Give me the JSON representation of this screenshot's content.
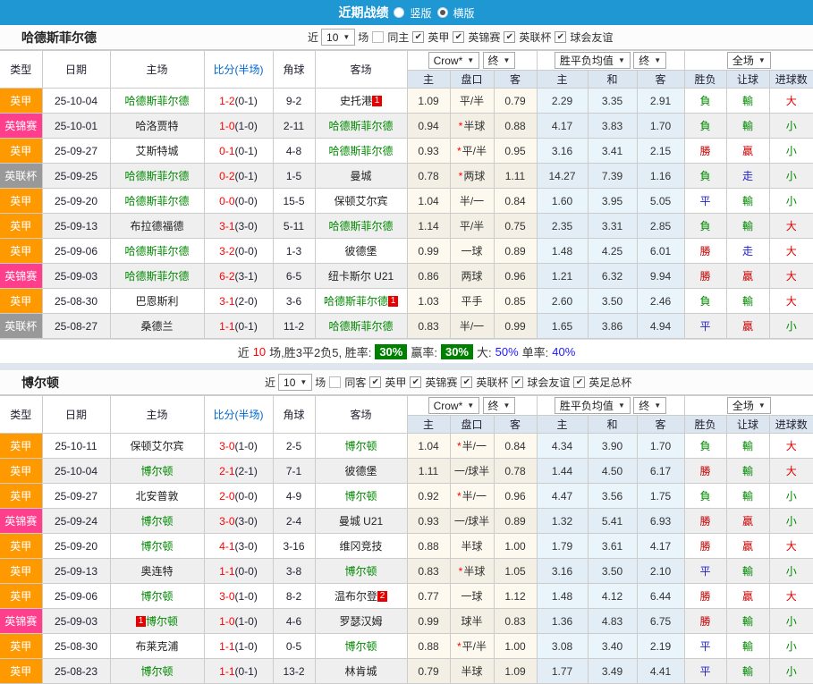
{
  "colors": {
    "accent_blue": "#1e97d3",
    "team_green": "#008800",
    "badge_red": "#e60000",
    "summary_badge_green": "#008000",
    "summary_dark": "#333333",
    "summary_red": "#ff0000",
    "summary_blue": "#1a1aff",
    "type_colors": {
      "英甲": "#ff9900",
      "英锦赛": "#ff3e8c",
      "英联杯": "#999999"
    },
    "result_colors": {
      "勝": "#cc0000",
      "贏": "#cc0000",
      "大": "#dd0000",
      "負": "#008800",
      "輸": "#008800",
      "小": "#008800",
      "平": "#2222cc",
      "走": "#2222cc"
    }
  },
  "topbar": {
    "title": "近期战绩",
    "vertical_label": "竖版",
    "horizontal_label": "横版",
    "selected": "横版"
  },
  "table_header": {
    "cols": [
      "类型",
      "日期",
      "主场",
      "比分(半场)",
      "角球",
      "客场"
    ],
    "sub": [
      "主",
      "盘口",
      "客",
      "主",
      "和",
      "客",
      "胜负",
      "让球",
      "进球数"
    ],
    "bookmaker_select": "Crow*",
    "final_select": "终",
    "avg_select": "胜平负均值",
    "final_select2": "终",
    "scope_select": "全场"
  },
  "sections": [
    {
      "team": "哈德斯菲尔德",
      "filter": {
        "prefix": "近",
        "count": "10",
        "suffix": "场",
        "same_label": "同主",
        "same_checked": false,
        "leagues": [
          {
            "label": "英甲",
            "checked": true
          },
          {
            "label": "英锦赛",
            "checked": true
          },
          {
            "label": "英联杯",
            "checked": true
          },
          {
            "label": "球会友谊",
            "checked": true
          }
        ]
      },
      "rows": [
        {
          "type": "英甲",
          "date": "25-10-04",
          "home": "哈德斯菲尔德",
          "home_team": true,
          "home_badge": "",
          "home_badge_pos": "",
          "score": "1-2",
          "half": "(0-1)",
          "corner": "9-2",
          "away": "史托港",
          "away_team": false,
          "away_badge": "1",
          "away_badge_pos": "after",
          "odds": [
            "1.09",
            "平/半",
            "0.79"
          ],
          "hcap_star": false,
          "avg": [
            "2.29",
            "3.35",
            "2.91"
          ],
          "result": "負",
          "handicap": "輸",
          "goals": "大"
        },
        {
          "type": "英锦赛",
          "date": "25-10-01",
          "home": "哈洛贾特",
          "home_team": false,
          "home_badge": "",
          "home_badge_pos": "",
          "score": "1-0",
          "half": "(1-0)",
          "corner": "2-11",
          "away": "哈德斯菲尔德",
          "away_team": true,
          "away_badge": "",
          "away_badge_pos": "",
          "odds": [
            "0.94",
            "半球",
            "0.88"
          ],
          "hcap_star": true,
          "avg": [
            "4.17",
            "3.83",
            "1.70"
          ],
          "result": "負",
          "handicap": "輸",
          "goals": "小"
        },
        {
          "type": "英甲",
          "date": "25-09-27",
          "home": "艾斯特城",
          "home_team": false,
          "home_badge": "",
          "home_badge_pos": "",
          "score": "0-1",
          "half": "(0-1)",
          "corner": "4-8",
          "away": "哈德斯菲尔德",
          "away_team": true,
          "away_badge": "",
          "away_badge_pos": "",
          "odds": [
            "0.93",
            "平/半",
            "0.95"
          ],
          "hcap_star": true,
          "avg": [
            "3.16",
            "3.41",
            "2.15"
          ],
          "result": "勝",
          "handicap": "贏",
          "goals": "小"
        },
        {
          "type": "英联杯",
          "date": "25-09-25",
          "home": "哈德斯菲尔德",
          "home_team": true,
          "home_badge": "",
          "home_badge_pos": "",
          "score": "0-2",
          "half": "(0-1)",
          "corner": "1-5",
          "away": "曼城",
          "away_team": false,
          "away_badge": "",
          "away_badge_pos": "",
          "odds": [
            "0.78",
            "两球",
            "1.11"
          ],
          "hcap_star": true,
          "avg": [
            "14.27",
            "7.39",
            "1.16"
          ],
          "result": "負",
          "handicap": "走",
          "goals": "小"
        },
        {
          "type": "英甲",
          "date": "25-09-20",
          "home": "哈德斯菲尔德",
          "home_team": true,
          "home_badge": "",
          "home_badge_pos": "",
          "score": "0-0",
          "half": "(0-0)",
          "corner": "15-5",
          "away": "保顿艾尔宾",
          "away_team": false,
          "away_badge": "",
          "away_badge_pos": "",
          "odds": [
            "1.04",
            "半/一",
            "0.84"
          ],
          "hcap_star": false,
          "avg": [
            "1.60",
            "3.95",
            "5.05"
          ],
          "result": "平",
          "handicap": "輸",
          "goals": "小"
        },
        {
          "type": "英甲",
          "date": "25-09-13",
          "home": "布拉德福德",
          "home_team": false,
          "home_badge": "",
          "home_badge_pos": "",
          "score": "3-1",
          "half": "(3-0)",
          "corner": "5-11",
          "away": "哈德斯菲尔德",
          "away_team": true,
          "away_badge": "",
          "away_badge_pos": "",
          "odds": [
            "1.14",
            "平/半",
            "0.75"
          ],
          "hcap_star": false,
          "avg": [
            "2.35",
            "3.31",
            "2.85"
          ],
          "result": "負",
          "handicap": "輸",
          "goals": "大"
        },
        {
          "type": "英甲",
          "date": "25-09-06",
          "home": "哈德斯菲尔德",
          "home_team": true,
          "home_badge": "",
          "home_badge_pos": "",
          "score": "3-2",
          "half": "(0-0)",
          "corner": "1-3",
          "away": "彼德堡",
          "away_team": false,
          "away_badge": "",
          "away_badge_pos": "",
          "odds": [
            "0.99",
            "一球",
            "0.89"
          ],
          "hcap_star": false,
          "avg": [
            "1.48",
            "4.25",
            "6.01"
          ],
          "result": "勝",
          "handicap": "走",
          "goals": "大"
        },
        {
          "type": "英锦赛",
          "date": "25-09-03",
          "home": "哈德斯菲尔德",
          "home_team": true,
          "home_badge": "",
          "home_badge_pos": "",
          "score": "6-2",
          "half": "(3-1)",
          "corner": "6-5",
          "away": "纽卡斯尔 U21",
          "away_team": false,
          "away_badge": "",
          "away_badge_pos": "",
          "odds": [
            "0.86",
            "两球",
            "0.96"
          ],
          "hcap_star": false,
          "avg": [
            "1.21",
            "6.32",
            "9.94"
          ],
          "result": "勝",
          "handicap": "贏",
          "goals": "大"
        },
        {
          "type": "英甲",
          "date": "25-08-30",
          "home": "巴恩斯利",
          "home_team": false,
          "home_badge": "",
          "home_badge_pos": "",
          "score": "3-1",
          "half": "(2-0)",
          "corner": "3-6",
          "away": "哈德斯菲尔德",
          "away_team": true,
          "away_badge": "1",
          "away_badge_pos": "after",
          "odds": [
            "1.03",
            "平手",
            "0.85"
          ],
          "hcap_star": false,
          "avg": [
            "2.60",
            "3.50",
            "2.46"
          ],
          "result": "負",
          "handicap": "輸",
          "goals": "大"
        },
        {
          "type": "英联杯",
          "date": "25-08-27",
          "home": "桑德兰",
          "home_team": false,
          "home_badge": "",
          "home_badge_pos": "",
          "score": "1-1",
          "half": "(0-1)",
          "corner": "11-2",
          "away": "哈德斯菲尔德",
          "away_team": true,
          "away_badge": "",
          "away_badge_pos": "",
          "odds": [
            "0.83",
            "半/一",
            "0.99"
          ],
          "hcap_star": false,
          "avg": [
            "1.65",
            "3.86",
            "4.94"
          ],
          "result": "平",
          "handicap": "贏",
          "goals": "小"
        }
      ],
      "summary": {
        "parts": [
          {
            "t": "近",
            "c": "dark"
          },
          {
            "t": "10",
            "c": "red"
          },
          {
            "t": "场,胜3平2负5, 胜率:",
            "c": "dark"
          },
          {
            "t": "30%",
            "badge": true
          },
          {
            "t": "赢率:",
            "c": "dark"
          },
          {
            "t": "30%",
            "badge": true
          },
          {
            "t": "大:",
            "c": "dark"
          },
          {
            "t": "50%",
            "c": "blue"
          },
          {
            "t": "单率:",
            "c": "dark"
          },
          {
            "t": "40%",
            "c": "blue"
          }
        ]
      }
    },
    {
      "team": "博尔顿",
      "filter": {
        "prefix": "近",
        "count": "10",
        "suffix": "场",
        "same_label": "同客",
        "same_checked": false,
        "leagues": [
          {
            "label": "英甲",
            "checked": true
          },
          {
            "label": "英锦赛",
            "checked": true
          },
          {
            "label": "英联杯",
            "checked": true
          },
          {
            "label": "球会友谊",
            "checked": true
          },
          {
            "label": "英足总杯",
            "checked": true
          }
        ]
      },
      "rows": [
        {
          "type": "英甲",
          "date": "25-10-11",
          "home": "保顿艾尔宾",
          "home_team": false,
          "home_badge": "",
          "home_badge_pos": "",
          "score": "3-0",
          "half": "(1-0)",
          "corner": "2-5",
          "away": "博尔顿",
          "away_team": true,
          "away_badge": "",
          "away_badge_pos": "",
          "odds": [
            "1.04",
            "半/一",
            "0.84"
          ],
          "hcap_star": true,
          "avg": [
            "4.34",
            "3.90",
            "1.70"
          ],
          "result": "負",
          "handicap": "輸",
          "goals": "大"
        },
        {
          "type": "英甲",
          "date": "25-10-04",
          "home": "博尔顿",
          "home_team": true,
          "home_badge": "",
          "home_badge_pos": "",
          "score": "2-1",
          "half": "(2-1)",
          "corner": "7-1",
          "away": "彼德堡",
          "away_team": false,
          "away_badge": "",
          "away_badge_pos": "",
          "odds": [
            "1.11",
            "一/球半",
            "0.78"
          ],
          "hcap_star": false,
          "avg": [
            "1.44",
            "4.50",
            "6.17"
          ],
          "result": "勝",
          "handicap": "輸",
          "goals": "大"
        },
        {
          "type": "英甲",
          "date": "25-09-27",
          "home": "北安普敦",
          "home_team": false,
          "home_badge": "",
          "home_badge_pos": "",
          "score": "2-0",
          "half": "(0-0)",
          "corner": "4-9",
          "away": "博尔顿",
          "away_team": true,
          "away_badge": "",
          "away_badge_pos": "",
          "odds": [
            "0.92",
            "半/一",
            "0.96"
          ],
          "hcap_star": true,
          "avg": [
            "4.47",
            "3.56",
            "1.75"
          ],
          "result": "負",
          "handicap": "輸",
          "goals": "小"
        },
        {
          "type": "英锦赛",
          "date": "25-09-24",
          "home": "博尔顿",
          "home_team": true,
          "home_badge": "",
          "home_badge_pos": "",
          "score": "3-0",
          "half": "(3-0)",
          "corner": "2-4",
          "away": "曼城 U21",
          "away_team": false,
          "away_badge": "",
          "away_badge_pos": "",
          "odds": [
            "0.93",
            "一/球半",
            "0.89"
          ],
          "hcap_star": false,
          "avg": [
            "1.32",
            "5.41",
            "6.93"
          ],
          "result": "勝",
          "handicap": "贏",
          "goals": "小"
        },
        {
          "type": "英甲",
          "date": "25-09-20",
          "home": "博尔顿",
          "home_team": true,
          "home_badge": "",
          "home_badge_pos": "",
          "score": "4-1",
          "half": "(3-0)",
          "corner": "3-16",
          "away": "维冈竞技",
          "away_team": false,
          "away_badge": "",
          "away_badge_pos": "",
          "odds": [
            "0.88",
            "半球",
            "1.00"
          ],
          "hcap_star": false,
          "avg": [
            "1.79",
            "3.61",
            "4.17"
          ],
          "result": "勝",
          "handicap": "贏",
          "goals": "大"
        },
        {
          "type": "英甲",
          "date": "25-09-13",
          "home": "奥连特",
          "home_team": false,
          "home_badge": "",
          "home_badge_pos": "",
          "score": "1-1",
          "half": "(0-0)",
          "corner": "3-8",
          "away": "博尔顿",
          "away_team": true,
          "away_badge": "",
          "away_badge_pos": "",
          "odds": [
            "0.83",
            "半球",
            "1.05"
          ],
          "hcap_star": true,
          "avg": [
            "3.16",
            "3.50",
            "2.10"
          ],
          "result": "平",
          "handicap": "輸",
          "goals": "小"
        },
        {
          "type": "英甲",
          "date": "25-09-06",
          "home": "博尔顿",
          "home_team": true,
          "home_badge": "",
          "home_badge_pos": "",
          "score": "3-0",
          "half": "(1-0)",
          "corner": "8-2",
          "away": "温布尔登",
          "away_team": false,
          "away_badge": "2",
          "away_badge_pos": "after",
          "odds": [
            "0.77",
            "一球",
            "1.12"
          ],
          "hcap_star": false,
          "avg": [
            "1.48",
            "4.12",
            "6.44"
          ],
          "result": "勝",
          "handicap": "贏",
          "goals": "大"
        },
        {
          "type": "英锦赛",
          "date": "25-09-03",
          "home": "博尔顿",
          "home_team": true,
          "home_badge": "1",
          "home_badge_pos": "before",
          "score": "1-0",
          "half": "(1-0)",
          "corner": "4-6",
          "away": "罗瑟汉姆",
          "away_team": false,
          "away_badge": "",
          "away_badge_pos": "",
          "odds": [
            "0.99",
            "球半",
            "0.83"
          ],
          "hcap_star": false,
          "avg": [
            "1.36",
            "4.83",
            "6.75"
          ],
          "result": "勝",
          "handicap": "輸",
          "goals": "小"
        },
        {
          "type": "英甲",
          "date": "25-08-30",
          "home": "布莱克浦",
          "home_team": false,
          "home_badge": "",
          "home_badge_pos": "",
          "score": "1-1",
          "half": "(1-0)",
          "corner": "0-5",
          "away": "博尔顿",
          "away_team": true,
          "away_badge": "",
          "away_badge_pos": "",
          "odds": [
            "0.88",
            "平/半",
            "1.00"
          ],
          "hcap_star": true,
          "avg": [
            "3.08",
            "3.40",
            "2.19"
          ],
          "result": "平",
          "handicap": "輸",
          "goals": "小"
        },
        {
          "type": "英甲",
          "date": "25-08-23",
          "home": "博尔顿",
          "home_team": true,
          "home_badge": "",
          "home_badge_pos": "",
          "score": "1-1",
          "half": "(0-1)",
          "corner": "13-2",
          "away": "林肯城",
          "away_team": false,
          "away_badge": "",
          "away_badge_pos": "",
          "odds": [
            "0.79",
            "半球",
            "1.09"
          ],
          "hcap_star": false,
          "avg": [
            "1.77",
            "3.49",
            "4.41"
          ],
          "result": "平",
          "handicap": "輸",
          "goals": "小"
        }
      ],
      "summary": null
    }
  ]
}
